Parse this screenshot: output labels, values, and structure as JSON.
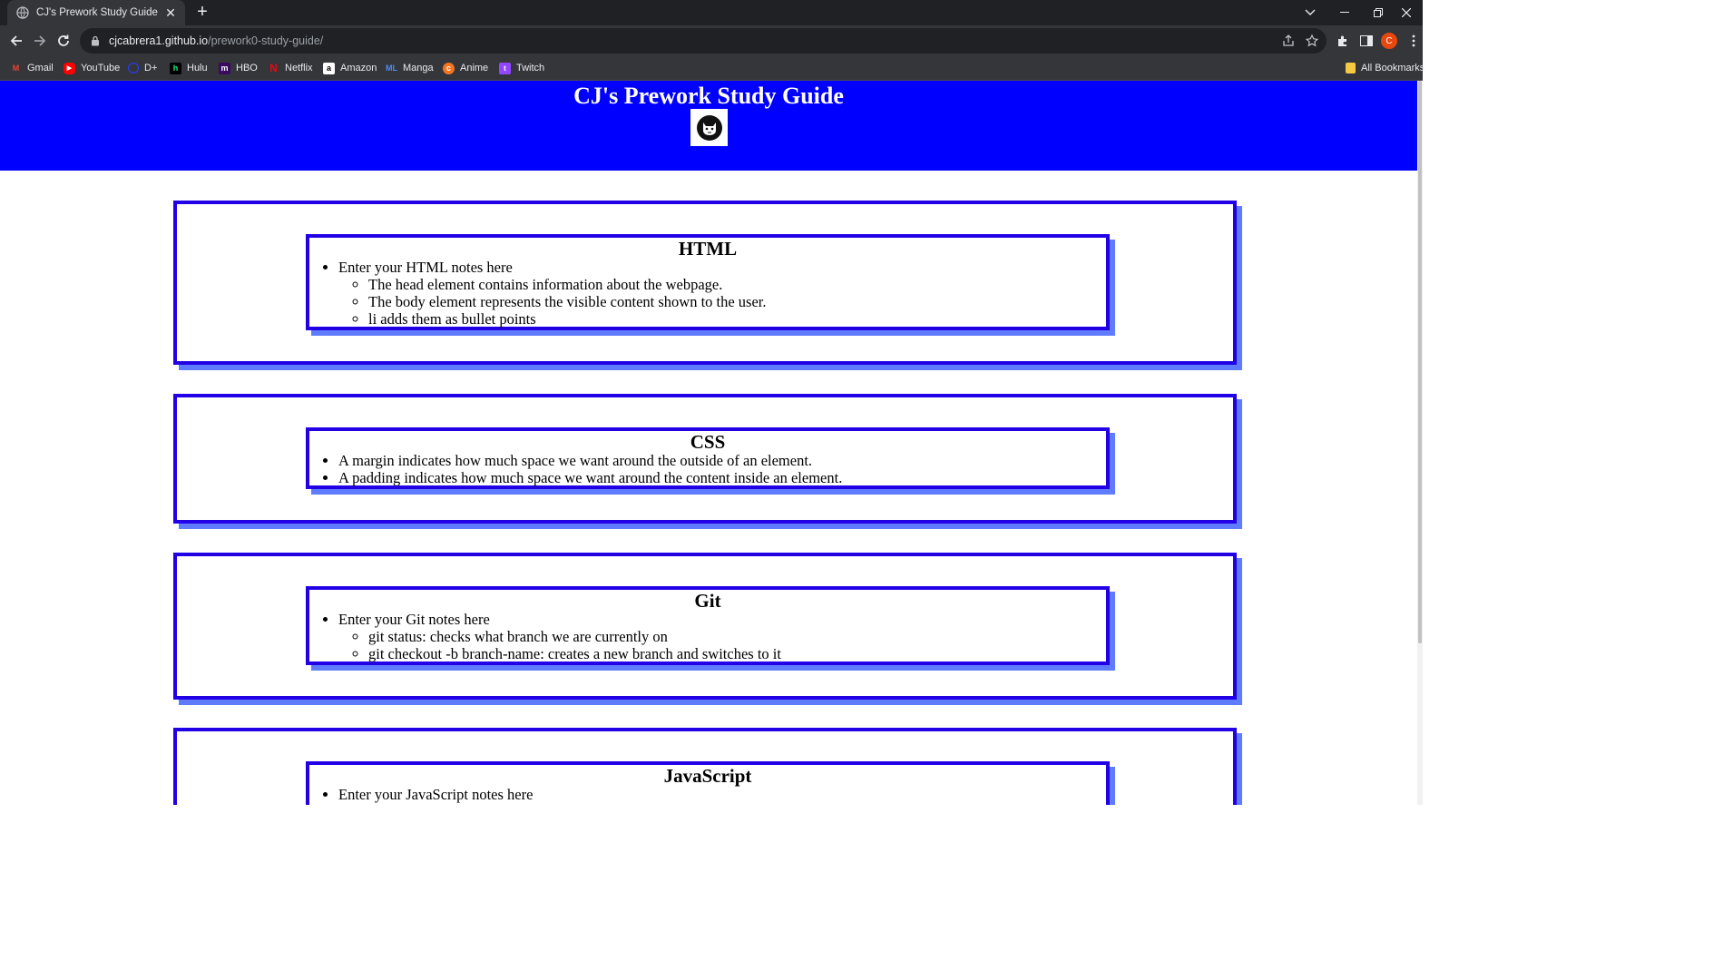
{
  "browser": {
    "tab_title": "CJ's Prework Study Guide",
    "url_host": "cjcabrera1.github.io",
    "url_path": "/prework0-study-guide/",
    "profile_initial": "C"
  },
  "bookmarks": [
    {
      "label": "Gmail"
    },
    {
      "label": "YouTube"
    },
    {
      "label": "D+"
    },
    {
      "label": "Hulu"
    },
    {
      "label": "HBO"
    },
    {
      "label": "Netflix"
    },
    {
      "label": "Amazon"
    },
    {
      "label": "Manga"
    },
    {
      "label": "Anime"
    },
    {
      "label": "Twitch"
    }
  ],
  "all_bookmarks": "All Bookmarks",
  "page": {
    "title": "CJ's Prework Study Guide",
    "sections": [
      {
        "heading": "HTML",
        "intro": "Enter your HTML notes here",
        "notes": [
          "The head element contains information about the webpage.",
          "The body element represents the visible content shown to the user.",
          "li adds them as bullet points"
        ]
      },
      {
        "heading": "CSS",
        "notes": [
          "A margin indicates how much space we want around the outside of an element.",
          "A padding indicates how much space we want around the content inside an element."
        ]
      },
      {
        "heading": "Git",
        "intro": "Enter your Git notes here",
        "notes": [
          "git status: checks what branch we are currently on",
          "git checkout -b branch-name: creates a new branch and switches to it"
        ]
      },
      {
        "heading": "JavaScript",
        "intro": "Enter your JavaScript notes here"
      }
    ]
  },
  "colors": {
    "header_bg": "#0000ff",
    "border": "#2200e6",
    "shadow": "#5f7cff"
  }
}
